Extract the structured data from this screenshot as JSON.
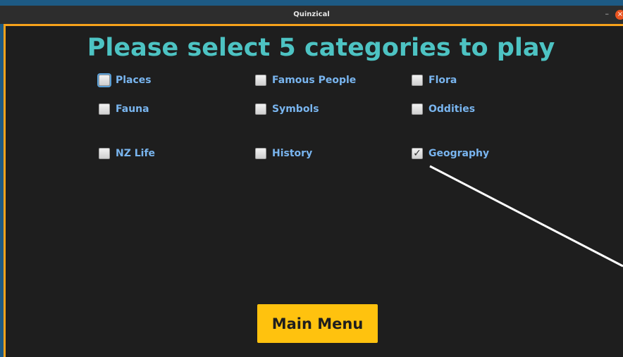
{
  "window": {
    "title": "Quinzical",
    "minimize_glyph": "–",
    "close_glyph": "×"
  },
  "heading": "Please select 5 categories to play",
  "categories": [
    {
      "label": "Places",
      "checked": false
    },
    {
      "label": "Famous People",
      "checked": false
    },
    {
      "label": "Flora",
      "checked": false
    },
    {
      "label": "Fauna",
      "checked": false
    },
    {
      "label": "Symbols",
      "checked": false
    },
    {
      "label": "Oddities",
      "checked": false
    },
    {
      "label": "NZ Life",
      "checked": false
    },
    {
      "label": "History",
      "checked": false
    },
    {
      "label": "Geography",
      "checked": true
    }
  ],
  "check_glyph": "✓",
  "main_menu_label": "Main Menu",
  "colors": {
    "accent": "#f7a21b",
    "heading": "#4dc3c3",
    "label": "#79b5ef",
    "button": "#ffc20e"
  }
}
